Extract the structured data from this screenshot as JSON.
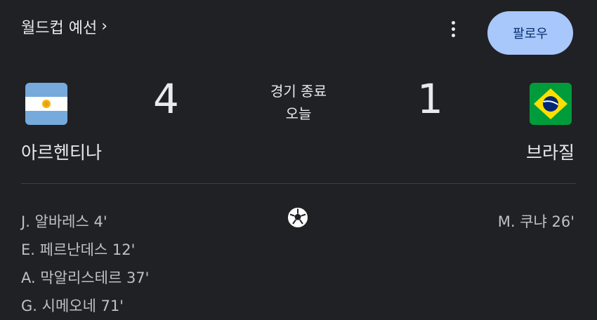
{
  "header": {
    "competition": "월드컵 예선",
    "chevron": "›",
    "more_icon": "more-vert-icon",
    "follow_label": "팔로우"
  },
  "match": {
    "status": "경기 종료",
    "date": "오늘",
    "home": {
      "name": "아르헨티나",
      "score": "4",
      "flag_icon": "argentina-flag-icon",
      "scorers": [
        "J. 알바레스 4'",
        "E. 페르난데스 12'",
        "A. 막알리스테르 37'",
        "G. 시메오네 71'"
      ]
    },
    "away": {
      "name": "브라질",
      "score": "1",
      "flag_icon": "brazil-flag-icon",
      "scorers": [
        "M. 쿠냐 26'"
      ]
    },
    "goal_icon": "soccer-ball-icon"
  },
  "colors": {
    "background": "#202124",
    "text": "#e8eaed",
    "follow_button_bg": "#a8c7fa",
    "follow_button_text": "#062e6f"
  }
}
